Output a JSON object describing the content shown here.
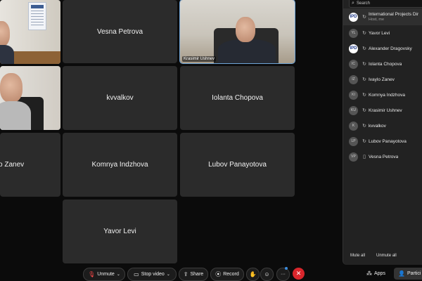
{
  "tiles": {
    "vesna": "Vesna Petrova",
    "krasimir_caption": "Krasimir Ushnev",
    "kvvalkov": "kvvalkov",
    "iolanta": "Iolanta Chopova",
    "zanev": "o Zanev",
    "komnya": "Komnya Indzhova",
    "lubov": "Lubov Panayotova",
    "yavor": "Yavor Levi"
  },
  "panel": {
    "search_placeholder": "Search",
    "participants": [
      {
        "initials": "IPD",
        "name": "International Projects Dir",
        "sub": "Host, me",
        "style": "ipd",
        "symbol": "↻"
      },
      {
        "initials": "YL",
        "name": "Yavor Levi",
        "sub": "",
        "style": "gray",
        "symbol": "↻"
      },
      {
        "initials": "IPD",
        "name": "Alexander Dragovsky",
        "sub": "",
        "style": "ipd",
        "symbol": "↻"
      },
      {
        "initials": "IC",
        "name": "Iolanta Chopova",
        "sub": "",
        "style": "gray",
        "symbol": "↻"
      },
      {
        "initials": "IZ",
        "name": "Ivaylo Zanev",
        "sub": "",
        "style": "gray",
        "symbol": "↻"
      },
      {
        "initials": "KI",
        "name": "Komnya Indzhova",
        "sub": "",
        "style": "gray",
        "symbol": "↻"
      },
      {
        "initials": "KU",
        "name": "Krasimir Ushnev",
        "sub": "",
        "style": "gray",
        "symbol": "↻"
      },
      {
        "initials": "K",
        "name": "kvvalkov",
        "sub": "",
        "style": "gray",
        "symbol": "↻"
      },
      {
        "initials": "LP",
        "name": "Lubov Panayotova",
        "sub": "",
        "style": "gray",
        "symbol": "↻"
      },
      {
        "initials": "VP",
        "name": "Vesna Petrova",
        "sub": "",
        "style": "gray",
        "symbol": "▯"
      }
    ],
    "mute_all": "Mute all",
    "unmute_all": "Unmute all"
  },
  "controls": {
    "unmute": "Unmute",
    "stop_video": "Stop video",
    "share": "Share",
    "record": "Record",
    "more": "···",
    "apps": "Apps",
    "participants": "Partici"
  }
}
